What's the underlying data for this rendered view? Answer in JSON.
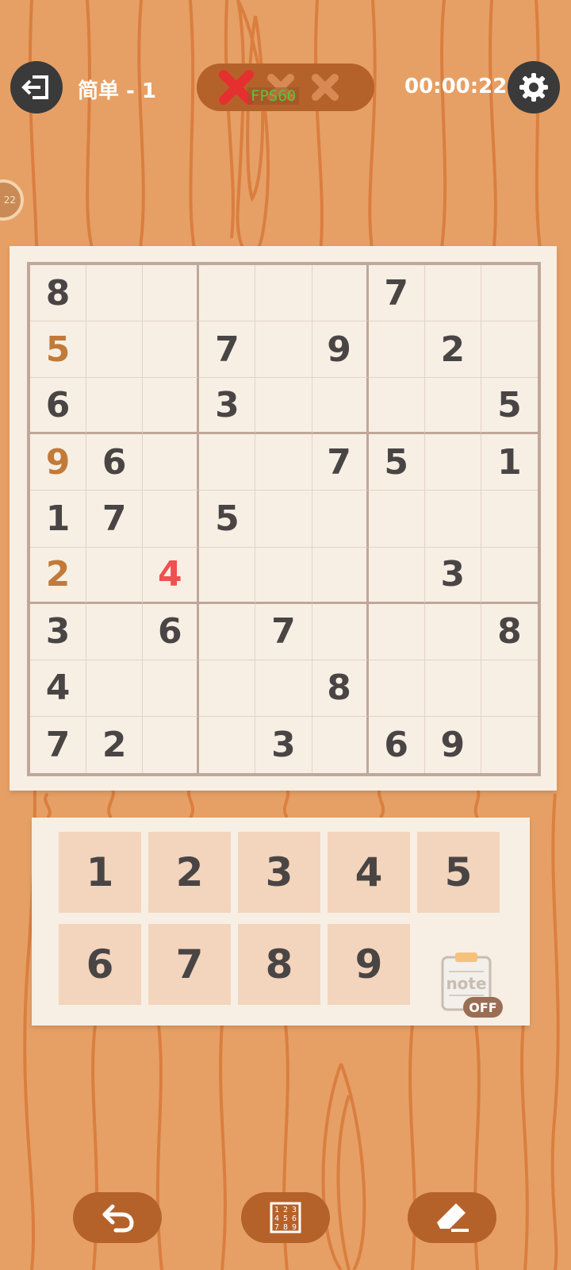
{
  "header": {
    "back_icon": "exit-icon",
    "level_label": "简单 - 1",
    "timer": "00:00:22",
    "settings_icon": "gear-icon",
    "fps_overlay": "FPS60",
    "mistakes": {
      "made": 1,
      "max": 3
    }
  },
  "side_badge": "22",
  "board": {
    "rows": [
      [
        {
          "v": "8",
          "t": "given"
        },
        {
          "v": "",
          "t": ""
        },
        {
          "v": "",
          "t": ""
        },
        {
          "v": "",
          "t": ""
        },
        {
          "v": "",
          "t": ""
        },
        {
          "v": "",
          "t": ""
        },
        {
          "v": "7",
          "t": "given"
        },
        {
          "v": "",
          "t": ""
        },
        {
          "v": "",
          "t": ""
        }
      ],
      [
        {
          "v": "5",
          "t": "user"
        },
        {
          "v": "",
          "t": ""
        },
        {
          "v": "",
          "t": ""
        },
        {
          "v": "7",
          "t": "given"
        },
        {
          "v": "",
          "t": ""
        },
        {
          "v": "9",
          "t": "given"
        },
        {
          "v": "",
          "t": ""
        },
        {
          "v": "2",
          "t": "given"
        },
        {
          "v": "",
          "t": ""
        }
      ],
      [
        {
          "v": "6",
          "t": "given"
        },
        {
          "v": "",
          "t": ""
        },
        {
          "v": "",
          "t": ""
        },
        {
          "v": "3",
          "t": "given"
        },
        {
          "v": "",
          "t": ""
        },
        {
          "v": "",
          "t": ""
        },
        {
          "v": "",
          "t": ""
        },
        {
          "v": "",
          "t": ""
        },
        {
          "v": "5",
          "t": "given"
        }
      ],
      [
        {
          "v": "9",
          "t": "user"
        },
        {
          "v": "6",
          "t": "given"
        },
        {
          "v": "",
          "t": ""
        },
        {
          "v": "",
          "t": ""
        },
        {
          "v": "",
          "t": ""
        },
        {
          "v": "7",
          "t": "given"
        },
        {
          "v": "5",
          "t": "given"
        },
        {
          "v": "",
          "t": ""
        },
        {
          "v": "1",
          "t": "given"
        }
      ],
      [
        {
          "v": "1",
          "t": "given"
        },
        {
          "v": "7",
          "t": "given"
        },
        {
          "v": "",
          "t": ""
        },
        {
          "v": "5",
          "t": "given"
        },
        {
          "v": "",
          "t": ""
        },
        {
          "v": "",
          "t": ""
        },
        {
          "v": "",
          "t": ""
        },
        {
          "v": "",
          "t": ""
        },
        {
          "v": "",
          "t": ""
        }
      ],
      [
        {
          "v": "2",
          "t": "user"
        },
        {
          "v": "",
          "t": ""
        },
        {
          "v": "4",
          "t": "error"
        },
        {
          "v": "",
          "t": ""
        },
        {
          "v": "",
          "t": ""
        },
        {
          "v": "",
          "t": ""
        },
        {
          "v": "",
          "t": ""
        },
        {
          "v": "3",
          "t": "given"
        },
        {
          "v": "",
          "t": ""
        }
      ],
      [
        {
          "v": "3",
          "t": "given"
        },
        {
          "v": "",
          "t": ""
        },
        {
          "v": "6",
          "t": "given"
        },
        {
          "v": "",
          "t": ""
        },
        {
          "v": "7",
          "t": "given"
        },
        {
          "v": "",
          "t": ""
        },
        {
          "v": "",
          "t": ""
        },
        {
          "v": "",
          "t": ""
        },
        {
          "v": "8",
          "t": "given"
        }
      ],
      [
        {
          "v": "4",
          "t": "given"
        },
        {
          "v": "",
          "t": ""
        },
        {
          "v": "",
          "t": ""
        },
        {
          "v": "",
          "t": ""
        },
        {
          "v": "",
          "t": ""
        },
        {
          "v": "8",
          "t": "given"
        },
        {
          "v": "",
          "t": ""
        },
        {
          "v": "",
          "t": ""
        },
        {
          "v": "",
          "t": ""
        }
      ],
      [
        {
          "v": "7",
          "t": "given"
        },
        {
          "v": "2",
          "t": "given"
        },
        {
          "v": "",
          "t": ""
        },
        {
          "v": "",
          "t": ""
        },
        {
          "v": "3",
          "t": "given"
        },
        {
          "v": "",
          "t": ""
        },
        {
          "v": "6",
          "t": "given"
        },
        {
          "v": "9",
          "t": "given"
        },
        {
          "v": "",
          "t": ""
        }
      ]
    ]
  },
  "numpad": {
    "keys": [
      "1",
      "2",
      "3",
      "4",
      "5",
      "6",
      "7",
      "8",
      "9"
    ],
    "note_label": "note",
    "note_state": "OFF"
  },
  "bottom_bar": {
    "undo_icon": "undo-icon",
    "candidates_icon": "number-grid-icon",
    "erase_icon": "eraser-icon",
    "grid_digits": [
      "1",
      "2",
      "3",
      "4",
      "5",
      "6",
      "7",
      "8",
      "9"
    ]
  },
  "colors": {
    "background": "#e6a065",
    "given": "#4a4545",
    "user": "#c17a3a",
    "error": "#ef5050",
    "pill": "#b5622a"
  }
}
